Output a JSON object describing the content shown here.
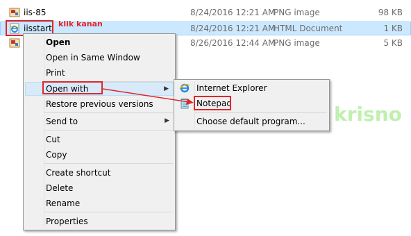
{
  "files": [
    {
      "name": "iis-85",
      "date": "8/24/2016 12:21 AM",
      "type": "PNG image",
      "size": "98 KB",
      "icon": "png-image-icon",
      "selected": false
    },
    {
      "name": "iisstart",
      "date": "8/24/2016 12:21 AM",
      "type": "HTML Document",
      "size": "1 KB",
      "icon": "ie-html-icon",
      "selected": true
    },
    {
      "name": "",
      "date": "8/26/2016 12:44 AM",
      "type": "PNG image",
      "size": "5 KB",
      "icon": "png-image-icon",
      "selected": false
    }
  ],
  "annotation": {
    "label": "klik kanan",
    "color": "#e0262b"
  },
  "context_menu": {
    "items": [
      {
        "label": "Open",
        "bold": true
      },
      {
        "label": "Open in Same Window"
      },
      {
        "label": "Print"
      },
      {
        "label": "Open with",
        "submenu": true,
        "highlighted": true
      },
      {
        "label": "Restore previous versions"
      },
      {
        "label": "Send to",
        "submenu": true
      },
      {
        "label": "Cut"
      },
      {
        "label": "Copy"
      },
      {
        "label": "Create shortcut"
      },
      {
        "label": "Delete"
      },
      {
        "label": "Rename"
      },
      {
        "label": "Properties"
      }
    ]
  },
  "submenu": {
    "items": [
      {
        "label": "Internet Explorer",
        "icon": "internet-explorer-icon"
      },
      {
        "label": "Notepad",
        "icon": "notepad-icon"
      },
      {
        "label": "Choose default program..."
      }
    ]
  },
  "watermark": "krisno",
  "colors": {
    "selection": "#cce8ff",
    "menu_bg": "#f0f0f0",
    "highlight": "#d8eaf9",
    "watermark": "#bff0b0"
  }
}
